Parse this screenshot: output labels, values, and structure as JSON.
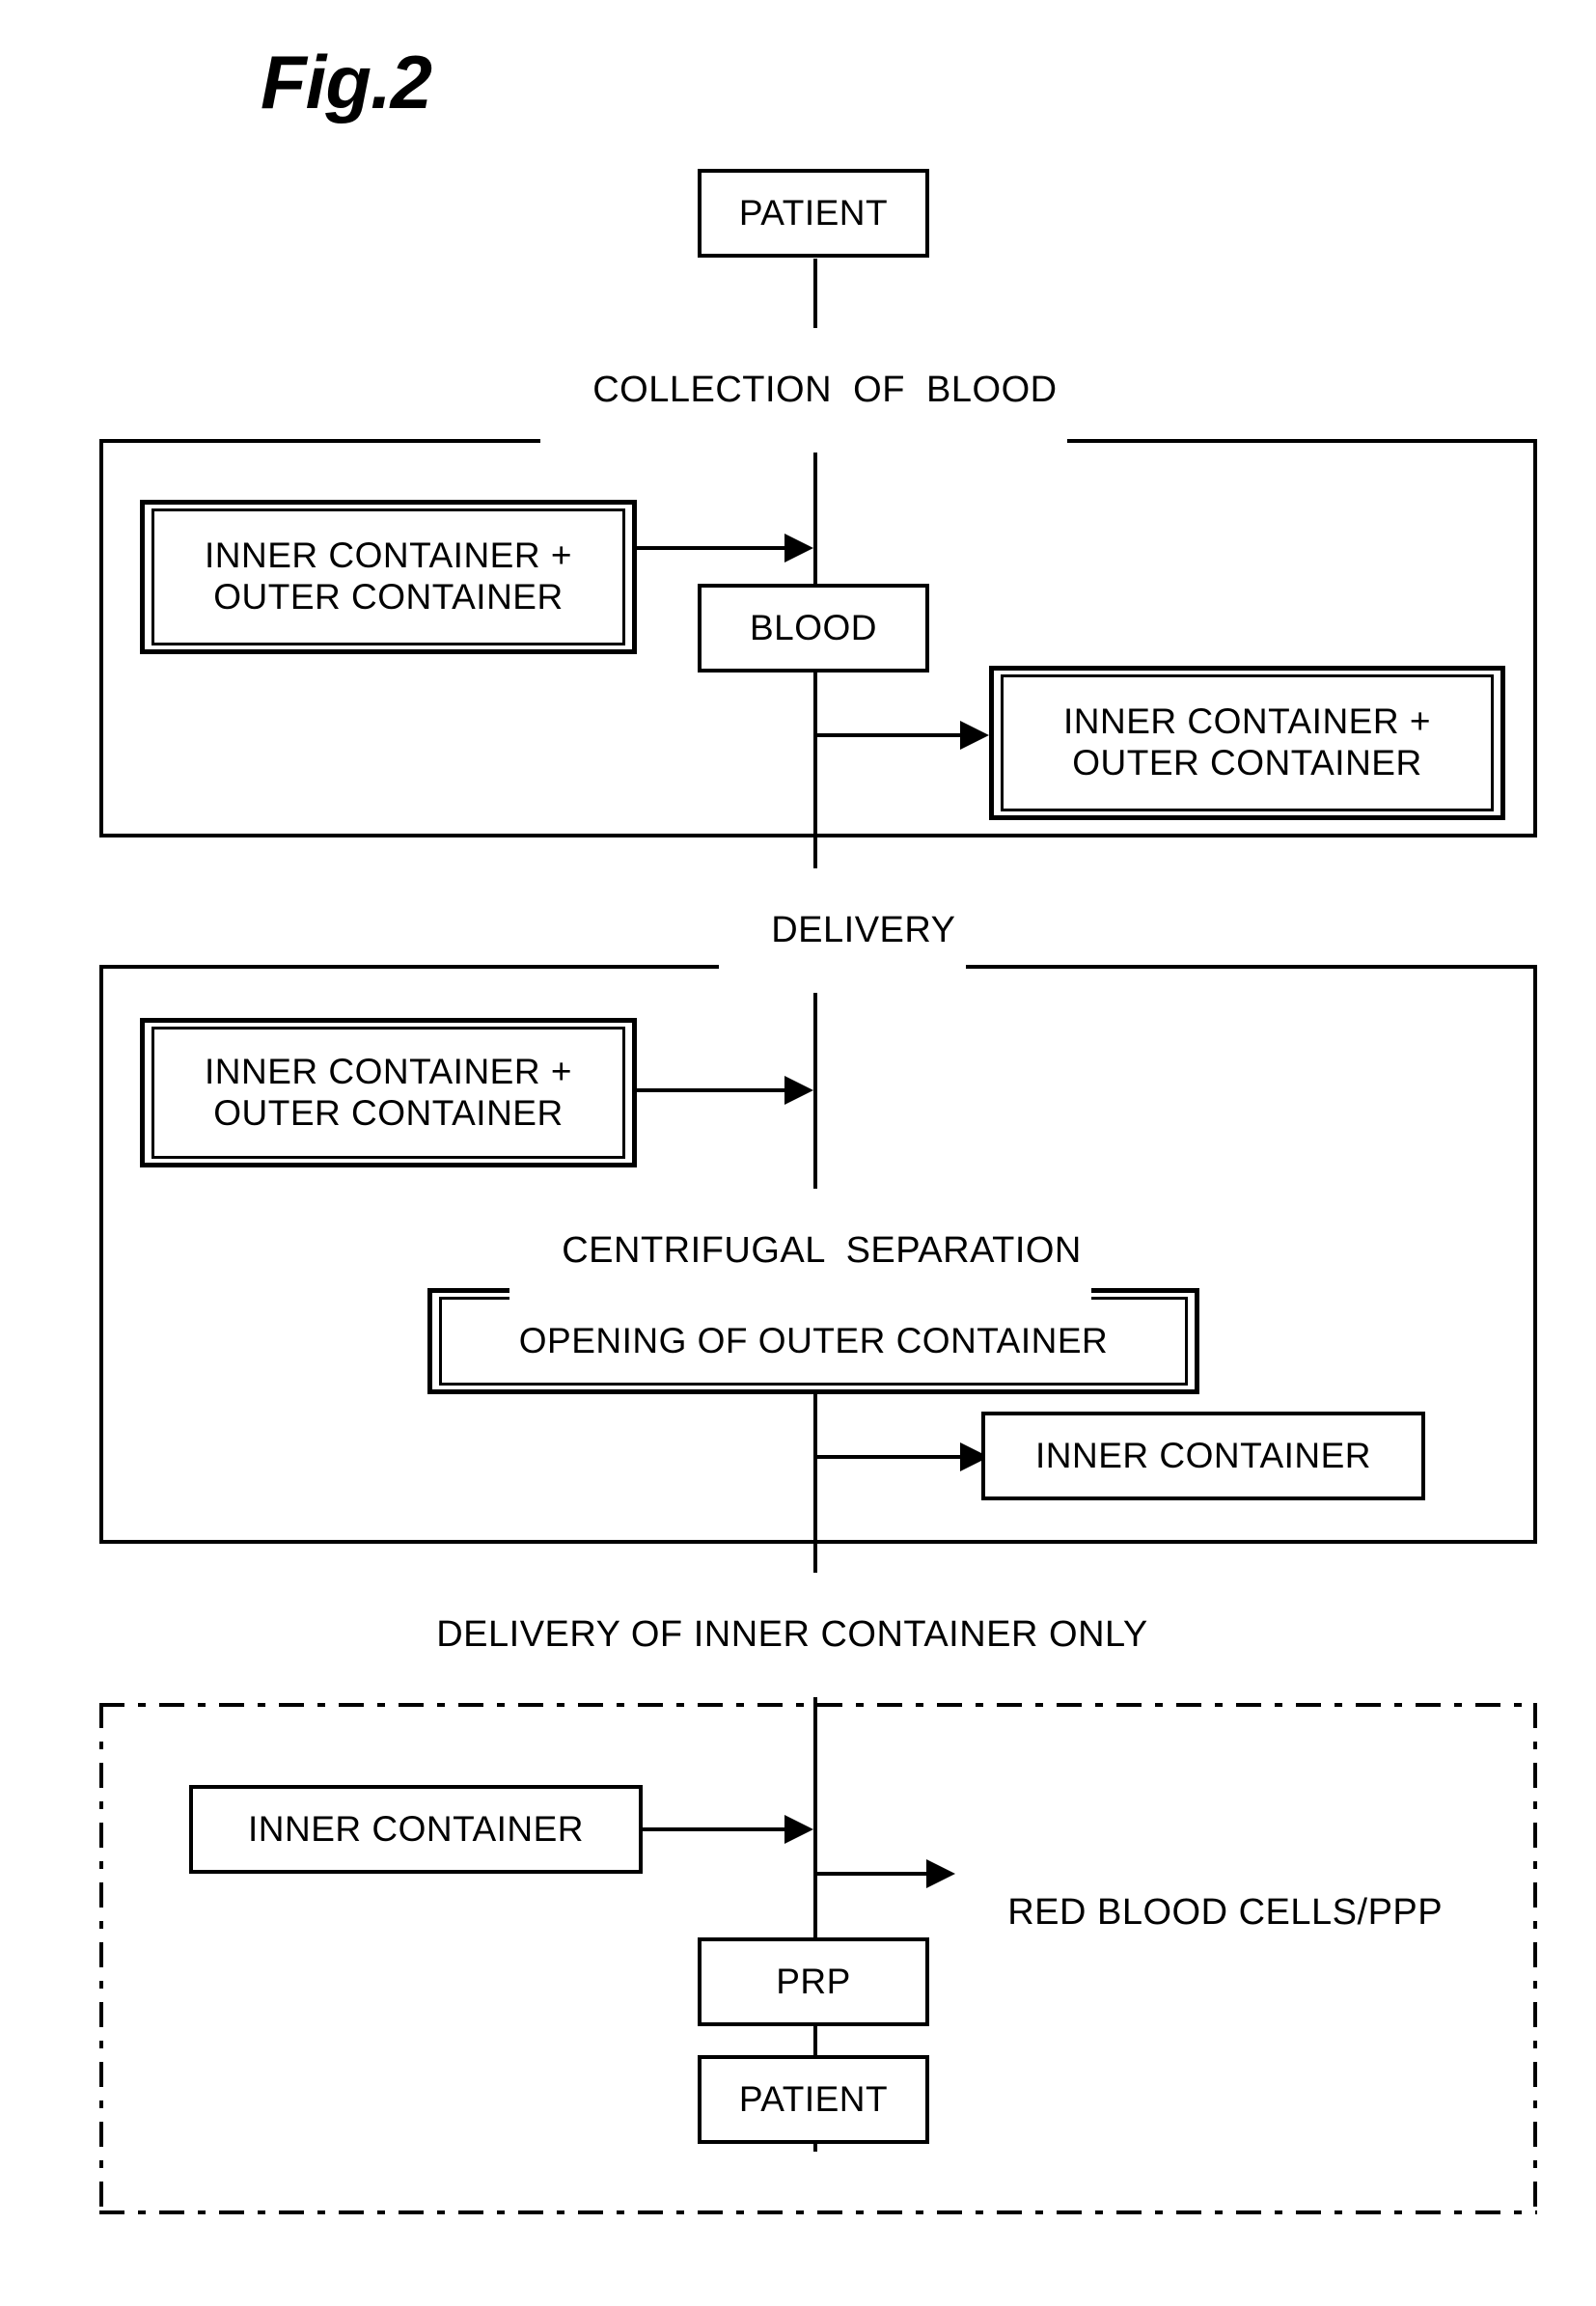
{
  "figure": {
    "title": "Fig.2"
  },
  "nodes": {
    "patient_top": "PATIENT",
    "collect_left_container": "INNER CONTAINER +\nOUTER CONTAINER",
    "blood": "BLOOD",
    "collect_right_container": "INNER CONTAINER +\nOUTER CONTAINER",
    "centrifuge_container": "INNER CONTAINER +\nOUTER CONTAINER",
    "opening_outer_container": "OPENING OF OUTER CONTAINER",
    "inner_container_stage2": "INNER CONTAINER",
    "inner_container_stage3": "INNER CONTAINER",
    "red_blood_cells": "RED BLOOD CELLS/PPP",
    "prp": "PRP",
    "patient_bottom": "PATIENT"
  },
  "stage_labels": {
    "collection_of_blood": "COLLECTION  OF  BLOOD",
    "delivery": "DELIVERY",
    "centrifugal_separation": "CENTRIFUGAL  SEPARATION",
    "delivery_inner_only": "DELIVERY OF INNER CONTAINER ONLY"
  },
  "colors": {
    "line": "#000000",
    "background": "#ffffff"
  },
  "chart_data": {
    "type": "diagram",
    "title": "Fig.2",
    "description": "Process flow diagram for blood collection, centrifugal separation and PRP delivery using inner and outer containers.",
    "stages": [
      {
        "name": "Collection of blood",
        "label": "COLLECTION  OF  BLOOD",
        "frame": "solid",
        "nodes": [
          "INNER CONTAINER + OUTER CONTAINER",
          "BLOOD",
          "INNER CONTAINER + OUTER CONTAINER"
        ]
      },
      {
        "name": "Delivery",
        "label": "DELIVERY",
        "frame": "none",
        "nodes": []
      },
      {
        "name": "Centrifugal separation",
        "label": "CENTRIFUGAL  SEPARATION",
        "frame": "solid",
        "nodes": [
          "INNER CONTAINER + OUTER CONTAINER",
          "OPENING OF OUTER CONTAINER",
          "INNER CONTAINER"
        ]
      },
      {
        "name": "Delivery of inner container only",
        "label": "DELIVERY OF INNER CONTAINER ONLY",
        "frame": "dash-dot",
        "nodes": [
          "INNER CONTAINER",
          "RED BLOOD CELLS/PPP",
          "PRP",
          "PATIENT"
        ]
      }
    ],
    "flow": [
      "PATIENT -> COLLECTION OF BLOOD",
      "INNER CONTAINER + OUTER CONTAINER -> BLOOD",
      "BLOOD -> INNER CONTAINER + OUTER CONTAINER",
      "DELIVERY",
      "INNER CONTAINER + OUTER CONTAINER -> CENTRIFUGAL SEPARATION",
      "CENTRIFUGAL SEPARATION -> OPENING OF OUTER CONTAINER",
      "OPENING OF OUTER CONTAINER -> INNER CONTAINER",
      "DELIVERY OF INNER CONTAINER ONLY",
      "INNER CONTAINER -> RED BLOOD CELLS/PPP",
      "INNER CONTAINER -> PRP",
      "PRP -> PATIENT"
    ]
  }
}
